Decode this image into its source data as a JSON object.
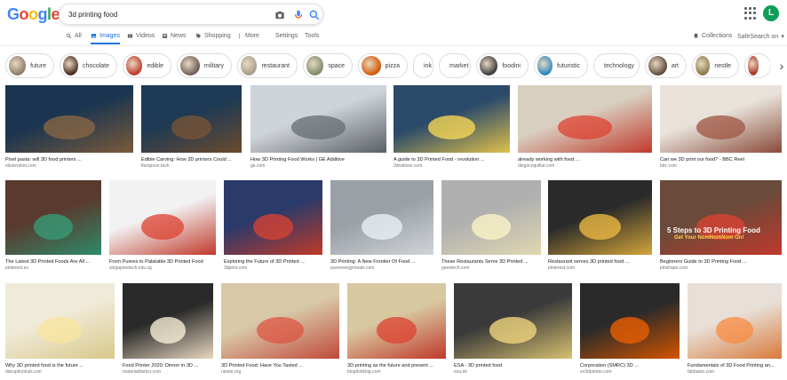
{
  "search": {
    "query": "3d printing food"
  },
  "logo": {
    "letters": [
      "G",
      "o",
      "o",
      "g",
      "l",
      "e"
    ],
    "colors": [
      "#4285f4",
      "#ea4335",
      "#fbbc05",
      "#4285f4",
      "#34a853",
      "#ea4335"
    ]
  },
  "user": {
    "initial": "L"
  },
  "tabs": [
    {
      "label": "All",
      "icon": "search-icon"
    },
    {
      "label": "Images",
      "icon": "image-icon"
    },
    {
      "label": "Videos",
      "icon": "video-icon"
    },
    {
      "label": "News",
      "icon": "news-icon"
    },
    {
      "label": "Shopping",
      "icon": "tag-icon"
    },
    {
      "label": "More",
      "icon": "more-icon"
    }
  ],
  "tools": {
    "settings": "Settings",
    "tools": "Tools",
    "collections": "Collections",
    "safesearch": "SafeSearch on"
  },
  "chips": [
    {
      "label": "future",
      "color": "#8d7b6a"
    },
    {
      "label": "chocolate",
      "color": "#4a2c20"
    },
    {
      "label": "edible",
      "color": "#c0392b"
    },
    {
      "label": "military",
      "color": "#6d5b55"
    },
    {
      "label": "restaurant",
      "color": "#a89c8d"
    },
    {
      "label": "space",
      "color": "#7a8a6a"
    },
    {
      "label": "pizza",
      "color": "#d35400"
    },
    {
      "label": "ink",
      "color": ""
    },
    {
      "label": "market",
      "color": ""
    },
    {
      "label": "foodini",
      "color": "#3a3a3a"
    },
    {
      "label": "futuristic",
      "color": "#2e86c1"
    },
    {
      "label": "technology",
      "color": ""
    },
    {
      "label": "art",
      "color": "#5c4a3d"
    },
    {
      "label": "nestle",
      "color": "#8a7b4a"
    },
    {
      "label": "",
      "color": "#b03a2e"
    }
  ],
  "results": [
    {
      "caption": "Pixel pasta: will 3D food printers ...",
      "source": "stickersbot.com",
      "colors": [
        "#1b3550",
        "#7a5a3a"
      ]
    },
    {
      "caption": "Edible Carving: How 3D printers Could ...",
      "source": "thespoon.tech",
      "colors": [
        "#1e3a54",
        "#6b4a2e"
      ]
    },
    {
      "caption": "How 3D Printing Food Works | GE Additive",
      "source": "ge.com",
      "colors": [
        "#cfd4d8",
        "#5a5f66"
      ]
    },
    {
      "caption": "A guide to 3D Printed Food - revolution ...",
      "source": "3dnatives.com",
      "colors": [
        "#2b4a6a",
        "#e0c04a"
      ]
    },
    {
      "caption": "already working with food ...",
      "source": "diegocoquillat.com",
      "colors": [
        "#d9cfc0",
        "#c0392b"
      ]
    },
    {
      "caption": "Can we 3D print our food? - BBC Reel",
      "source": "bbc.com",
      "colors": [
        "#e8e2da",
        "#8a4a3a"
      ]
    },
    {
      "caption": "The Latest 3D Printed Foods Are All ...",
      "source": "pinterest.es",
      "colors": [
        "#5a3a2e",
        "#2e8a6a"
      ]
    },
    {
      "caption": "From Purees to Palatable 3D Printed Food",
      "source": "singaporetech.edu.sg",
      "colors": [
        "#f2f2f2",
        "#c0392b"
      ]
    },
    {
      "caption": "Exploring the Future of 3D Printed ...",
      "source": "3dprint.com",
      "colors": [
        "#2a3a6a",
        "#c0392b"
      ]
    },
    {
      "caption": "3D Printing: A New Frontier Of Food ...",
      "source": "pureenergymeals.com",
      "colors": [
        "#9aa0a6",
        "#d0d4d8"
      ]
    },
    {
      "caption": "These Restaurants Serve 3D Printed ...",
      "source": "geeetech.com",
      "colors": [
        "#b0b0b0",
        "#e0d8b0"
      ]
    },
    {
      "caption": "Restaurant serves 3D printed food ...",
      "source": "pinterest.com",
      "colors": [
        "#2a2a2a",
        "#d4a53a"
      ]
    },
    {
      "caption": "Beginners Guide to 3D Printing Food ...",
      "source": "pinshape.com",
      "colors": [
        "#6a4a3a",
        "#c0392b"
      ]
    },
    {
      "caption": "Why 3D printed food is the future ...",
      "source": "disruptionhub.com",
      "colors": [
        "#f0ead8",
        "#d9c88a"
      ]
    },
    {
      "caption": "Food Printer 2020: Dinner in 3D ...",
      "source": "materialdistrict.com",
      "colors": [
        "#2a2a2a",
        "#e8d8c0"
      ]
    },
    {
      "caption": "3D Printed Food: Have You Tasted ...",
      "source": "nexter.org",
      "colors": [
        "#d8c8a8",
        "#c04a3a"
      ]
    },
    {
      "caption": "3D printing as the future and present ...",
      "source": "blogthinkbig.com",
      "colors": [
        "#d8c8a0",
        "#c0392b"
      ]
    },
    {
      "caption": "ESA - 3D printed food",
      "source": "esa.int",
      "colors": [
        "#3a3a3a",
        "#d8c070"
      ]
    },
    {
      "caption": "Corporation (SMRC) 3D ...",
      "source": "ev3dprinter.com",
      "colors": [
        "#2a2a2a",
        "#d35400"
      ]
    },
    {
      "caption": "Fundamentals of 3D Food Printing an...",
      "source": "fabbaloo.com",
      "colors": [
        "#e8e0d8",
        "#d87a3a"
      ]
    }
  ],
  "overlay": {
    "title": "5 Steps to 3D Printing Food",
    "subtitle": "Get Your NomNomNom On!"
  }
}
